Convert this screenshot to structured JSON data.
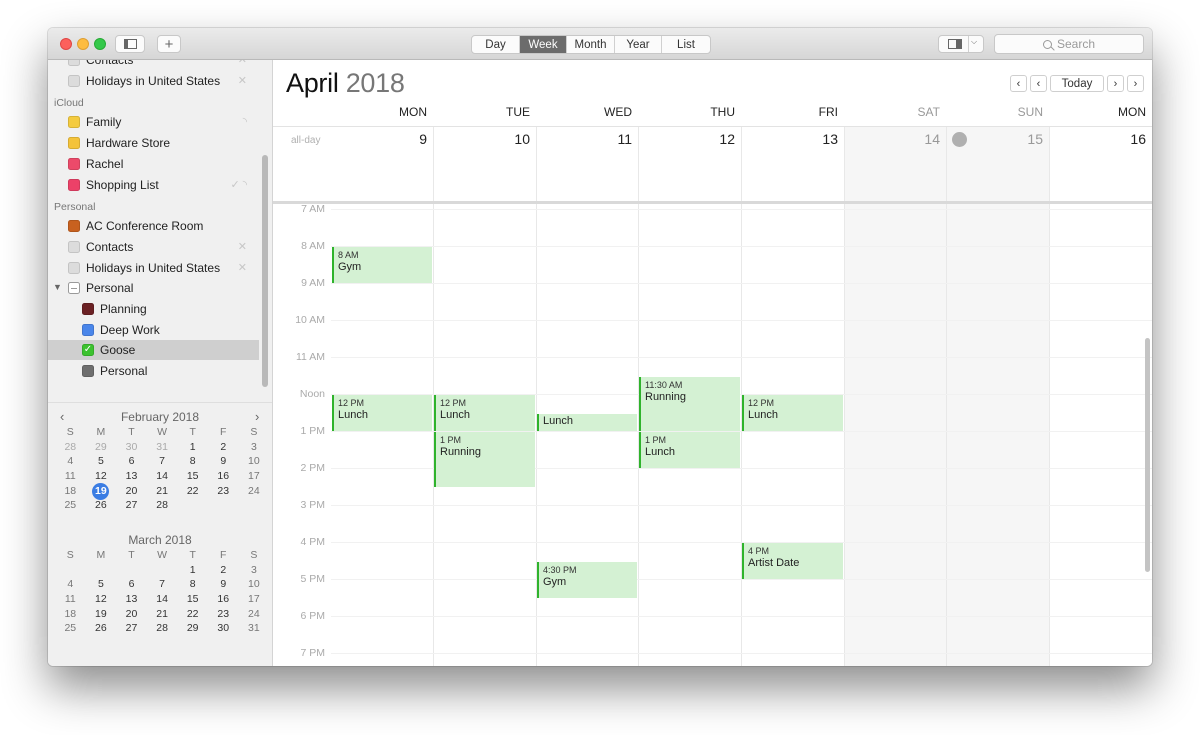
{
  "toolbar": {
    "sidebar_toggle_icon": "sidebar-toggle-icon",
    "add_label": "+",
    "views": [
      {
        "label": "Day",
        "active": false
      },
      {
        "label": "Week",
        "active": true
      },
      {
        "label": "Month",
        "active": false
      },
      {
        "label": "Year",
        "active": false
      },
      {
        "label": "List",
        "active": false
      }
    ],
    "inspector_icon": "inspector-icon",
    "search_placeholder": "Search"
  },
  "sidebar": {
    "top_items": [
      {
        "label": "Contacts",
        "color": "#d6d6d6",
        "side_icon": "✕"
      },
      {
        "label": "Holidays in United States",
        "color": "#d6d6d6",
        "side_icon": "✕"
      }
    ],
    "groups": [
      {
        "label": "iCloud",
        "items": [
          {
            "label": "Family",
            "color": "#f4cb3f",
            "side_icon": "◝"
          },
          {
            "label": "Hardware Store",
            "color": "#f4c33a",
            "side_icon": ""
          },
          {
            "label": "Rachel",
            "color": "#ec4a6a",
            "side_icon": ""
          },
          {
            "label": "Shopping List",
            "color": "#ec4168",
            "side_icon": "✓ ◝"
          }
        ]
      },
      {
        "label": "Personal",
        "items": [
          {
            "label": "AC Conference Room",
            "color": "#c8611f",
            "side_icon": ""
          },
          {
            "label": "Contacts",
            "color": "#d6d6d6",
            "side_icon": "✕"
          },
          {
            "label": "Holidays in United States",
            "color": "#d6d6d6",
            "side_icon": "✕"
          },
          {
            "label": "Personal",
            "color": "#9a9a9a",
            "side_icon": "",
            "expanded": true,
            "mixed": true
          },
          {
            "label": "Planning",
            "color": "#6b2124",
            "side_icon": "",
            "indent": true
          },
          {
            "label": "Deep Work",
            "color": "#4a86ea",
            "side_icon": "",
            "indent": true
          },
          {
            "label": "Goose",
            "color": "#3cc22f",
            "side_icon": "",
            "indent": true,
            "checked": true,
            "selected": true
          },
          {
            "label": "Personal",
            "color": "#6e6e6e",
            "side_icon": "",
            "indent": true
          }
        ]
      }
    ]
  },
  "mini_calendars": [
    {
      "title": "February 2018",
      "weekdays": [
        "S",
        "M",
        "T",
        "W",
        "T",
        "F",
        "S"
      ],
      "weeks": [
        [
          "28",
          "29",
          "30",
          "31",
          "1",
          "2",
          "3"
        ],
        [
          "4",
          "5",
          "6",
          "7",
          "8",
          "9",
          "10"
        ],
        [
          "11",
          "12",
          "13",
          "14",
          "15",
          "16",
          "17"
        ],
        [
          "18",
          "19",
          "20",
          "21",
          "22",
          "23",
          "24"
        ],
        [
          "25",
          "26",
          "27",
          "28",
          "",
          "",
          ""
        ]
      ],
      "other_month_first_row": 4,
      "today": "19",
      "prev_label": "‹",
      "next_label": "›"
    },
    {
      "title": "March 2018",
      "weekdays": [
        "S",
        "M",
        "T",
        "W",
        "T",
        "F",
        "S"
      ],
      "weeks": [
        [
          "",
          "",
          "",
          "",
          "1",
          "2",
          "3"
        ],
        [
          "4",
          "5",
          "6",
          "7",
          "8",
          "9",
          "10"
        ],
        [
          "11",
          "12",
          "13",
          "14",
          "15",
          "16",
          "17"
        ],
        [
          "18",
          "19",
          "20",
          "21",
          "22",
          "23",
          "24"
        ],
        [
          "25",
          "26",
          "27",
          "28",
          "29",
          "30",
          "31"
        ]
      ]
    }
  ],
  "main": {
    "month": "April",
    "year": "2018",
    "nav": {
      "prev_prev": "‹",
      "prev": "‹",
      "today": "Today",
      "next": "›",
      "next_next": "›"
    },
    "allday_label": "all-day",
    "days": [
      {
        "name": "MON",
        "num": "9",
        "weekend": false
      },
      {
        "name": "TUE",
        "num": "10",
        "weekend": false
      },
      {
        "name": "WED",
        "num": "11",
        "weekend": false
      },
      {
        "name": "THU",
        "num": "12",
        "weekend": false
      },
      {
        "name": "FRI",
        "num": "13",
        "weekend": false
      },
      {
        "name": "SAT",
        "num": "14",
        "weekend": true
      },
      {
        "name": "SUN",
        "num": "15",
        "weekend": true
      },
      {
        "name": "MON",
        "num": "16",
        "weekend": false
      }
    ],
    "hours": [
      "7 AM",
      "8 AM",
      "9 AM",
      "10 AM",
      "11 AM",
      "Noon",
      "1 PM",
      "2 PM",
      "3 PM",
      "4 PM",
      "5 PM",
      "6 PM",
      "7 PM"
    ],
    "first_hour": 7,
    "events": [
      {
        "day": 0,
        "start": 8.0,
        "end": 9.0,
        "time": "8 AM",
        "title": "Gym"
      },
      {
        "day": 0,
        "start": 12.0,
        "end": 13.0,
        "time": "12 PM",
        "title": "Lunch"
      },
      {
        "day": 1,
        "start": 12.0,
        "end": 13.0,
        "time": "12 PM",
        "title": "Lunch"
      },
      {
        "day": 1,
        "start": 13.0,
        "end": 14.5,
        "time": "1 PM",
        "title": "Running"
      },
      {
        "day": 2,
        "start": 12.5,
        "end": 13.0,
        "time": "",
        "title": "Lunch"
      },
      {
        "day": 2,
        "start": 16.5,
        "end": 17.5,
        "time": "4:30 PM",
        "title": "Gym"
      },
      {
        "day": 3,
        "start": 11.5,
        "end": 13.0,
        "time": "11:30 AM",
        "title": "Running"
      },
      {
        "day": 3,
        "start": 13.0,
        "end": 14.0,
        "time": "1 PM",
        "title": "Lunch"
      },
      {
        "day": 4,
        "start": 12.0,
        "end": 13.0,
        "time": "12 PM",
        "title": "Lunch"
      },
      {
        "day": 4,
        "start": 16.0,
        "end": 17.0,
        "time": "4 PM",
        "title": "Artist Date"
      }
    ]
  }
}
